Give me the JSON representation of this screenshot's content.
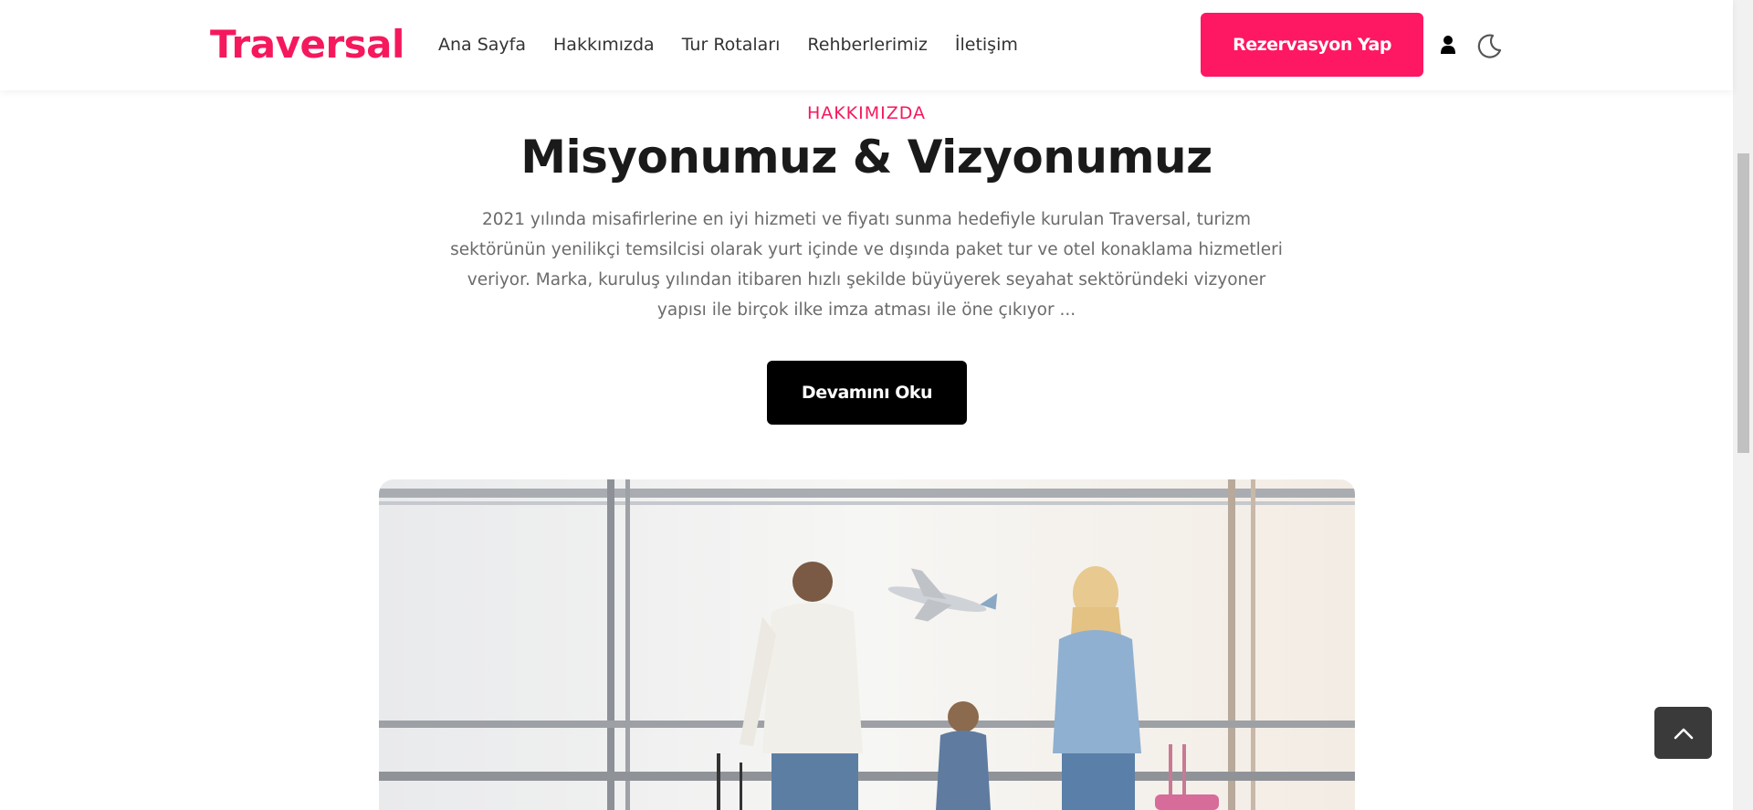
{
  "header": {
    "logo": "Traversal",
    "nav": [
      "Ana Sayfa",
      "Hakkımızda",
      "Tur Rotaları",
      "Rehberlerimiz",
      "İletişim"
    ],
    "cta_label": "Rezervasyon Yap",
    "icons": [
      "user-icon",
      "moon-icon"
    ]
  },
  "about": {
    "eyebrow": "HAKKIMIZDA",
    "title": "Misyonumuz & Vizyonumuz",
    "description": "2021 yılında misafirlerine en iyi hizmeti ve fiyatı sunma hedefiyle kurulan Traversal, turizm sektörünün yenilikçi temsilcisi olarak yurt içinde ve dışında paket tur ve otel konaklama hizmetleri veriyor. Marka, kuruluş yılından itibaren hızlı şekilde büyüyerek seyahat sektöründeki vizyoner yapısı ile birçok ilke imza atması ile öne çıkıyor ...",
    "read_more_label": "Devamını Oku"
  },
  "colors": {
    "brand": "#f5185d",
    "cta": "#fe1762",
    "dark_button": "#000000",
    "to_top": "#3a3a3a"
  },
  "floating": {
    "to_top_icon": "chevron-up-icon"
  }
}
